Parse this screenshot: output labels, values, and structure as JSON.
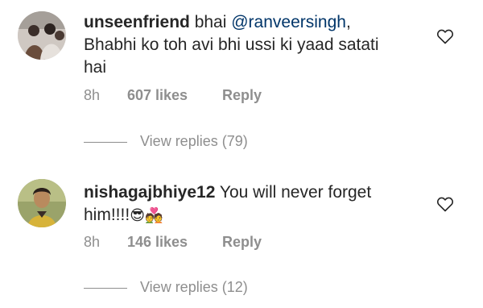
{
  "comments": [
    {
      "username": "unseenfriend",
      "text_before_mention": " bhai ",
      "mention": "@ranveersingh",
      "text_after_mention": ",",
      "line2": "Bhabhi ko toh avi bhi ussi ki yaad satati",
      "line3": "hai",
      "time": "8h",
      "likes": "607 likes",
      "reply": "Reply",
      "view_replies": "View replies (79)"
    },
    {
      "username": "nishagajbhiye12",
      "text": " You will never forget",
      "line2": "him!!!!",
      "emoji1": "😎",
      "emoji2": "💑",
      "time": "8h",
      "likes": "146 likes",
      "reply": "Reply",
      "view_replies": "View replies (12)"
    }
  ],
  "colors": {
    "text": "#262626",
    "secondary": "#8e8e8e",
    "mention": "#003569"
  },
  "icons": {
    "like": "heart-outline-icon"
  }
}
